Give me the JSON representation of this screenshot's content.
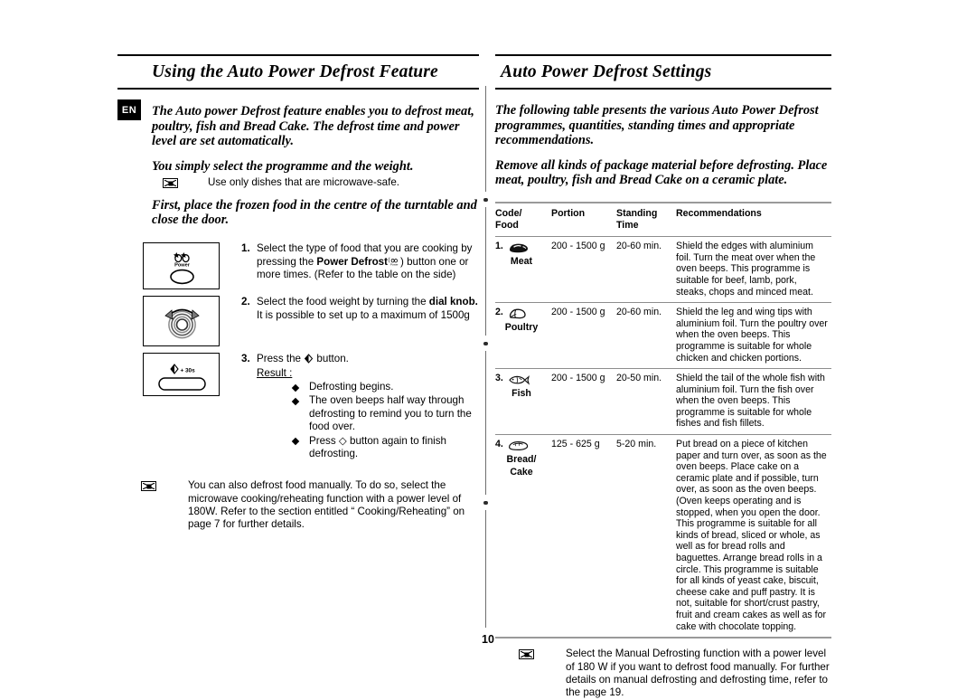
{
  "document": {
    "language_badge": "EN",
    "page_number": "10"
  },
  "left": {
    "title": "Using the Auto Power Defrost Feature",
    "lead_1": "The Auto power Defrost feature enables you to defrost meat, poultry, fish and Bread Cake. The defrost time and power level are set automatically.",
    "lead_2": "You simply select the programme and the weight.",
    "note_microwave_safe": "Use only dishes that are microwave-safe.",
    "lead_3": "First, place the frozen food in the centre of the turntable and close the door.",
    "steps": [
      {
        "number": "1.",
        "text_before": "Select the type of food that you are cooking by pressing the ",
        "bold": "Power Defrost",
        "text_after": ") button one or more times. (Refer to the table on the side)",
        "figure": "power-defrost-button-illustration",
        "figure_caption": "Power"
      },
      {
        "number": "2.",
        "text_before": "Select the food weight by turning the ",
        "bold": "dial knob.",
        "text_after": " It is possible to set up to a maximum of 1500g",
        "figure": "dial-knob-illustration"
      },
      {
        "number": "3.",
        "text_before": "Press the ",
        "text_after": " button.",
        "figure": "start-30s-button-illustration",
        "figure_caption": "+ 30s",
        "result_label": "Result :",
        "results": [
          "Defrosting begins.",
          "The oven beeps half way through defrosting to remind you to turn the food over.",
          "Press ◇ button again to finish defrosting."
        ]
      }
    ],
    "note_manual_defrost": "You can also defrost food manually. To do so, select the microwave cooking/reheating function with a power level of 180W. Refer to the section entitled “ Cooking/Reheating” on page 7 for further details."
  },
  "right": {
    "title": "Auto Power Defrost Settings",
    "lead_1": "The following table presents the various Auto Power Defrost programmes, quantities, standing times and appropriate recommendations.",
    "lead_2": "Remove all kinds of package material before defrosting. Place meat, poultry, fish and Bread Cake on a ceramic plate.",
    "table": {
      "headers": [
        "Code/ Food",
        "Portion",
        "Standing Time",
        "Recommendations"
      ],
      "header_code_line1": "Code/",
      "header_code_line2": "Food",
      "header_portion": "Portion",
      "header_standing_line1": "Standing",
      "header_standing_line2": "Time",
      "header_recommendations": "Recommendations",
      "rows": [
        {
          "number": "1.",
          "icon": "meat-icon",
          "food": "Meat",
          "portion": "200 - 1500 g",
          "standing_time": "20-60 min.",
          "recommendations": "Shield the edges with aluminium foil. Turn the meat over when the oven beeps. This programme is suitable for beef, lamb, pork, steaks, chops and minced meat."
        },
        {
          "number": "2.",
          "icon": "poultry-icon",
          "food": "Poultry",
          "portion": "200 - 1500 g",
          "standing_time": "20-60 min.",
          "recommendations": "Shield the leg and wing tips with aluminium foil. Turn the poultry over when the oven beeps. This programme is suitable for whole chicken and chicken portions."
        },
        {
          "number": "3.",
          "icon": "fish-icon",
          "food": "Fish",
          "portion": "200 - 1500 g",
          "standing_time": "20-50 min.",
          "recommendations": "Shield the tail of the whole fish with aluminium foil. Turn the fish over when the oven beeps. This programme is suitable for whole fishes and fish fillets."
        },
        {
          "number": "4.",
          "icon": "bread-cake-icon",
          "food": "Bread/ Cake",
          "food_line1": "Bread/",
          "food_line2": "Cake",
          "portion": "125 - 625 g",
          "standing_time": "5-20 min.",
          "recommendations": "Put bread on a piece of kitchen paper and turn over, as soon as the oven beeps. Place cake on a ceramic plate and if possible, turn over, as soon as the oven beeps. (Oven keeps operating and is stopped, when you open the door. This programme is suitable for all kinds of bread, sliced or whole, as well as for bread rolls and baguettes. Arrange bread rolls in a circle. This programme is suitable for all kinds of yeast cake, biscuit, cheese cake and puff pastry. It is not, suitable for short/crust pastry, fruit and cream cakes as well as for cake with chocolate topping."
        }
      ]
    },
    "note_manual_defrosting": "Select the Manual Defrosting function with a power level of 180 W if you want to defrost food manually. For further details on manual defrosting and defrosting time, refer to the page 19."
  },
  "colors": {
    "text": "#000000",
    "rule": "#000000",
    "table_rule": "#9a9a9a",
    "divider": "#6f6f6f"
  }
}
